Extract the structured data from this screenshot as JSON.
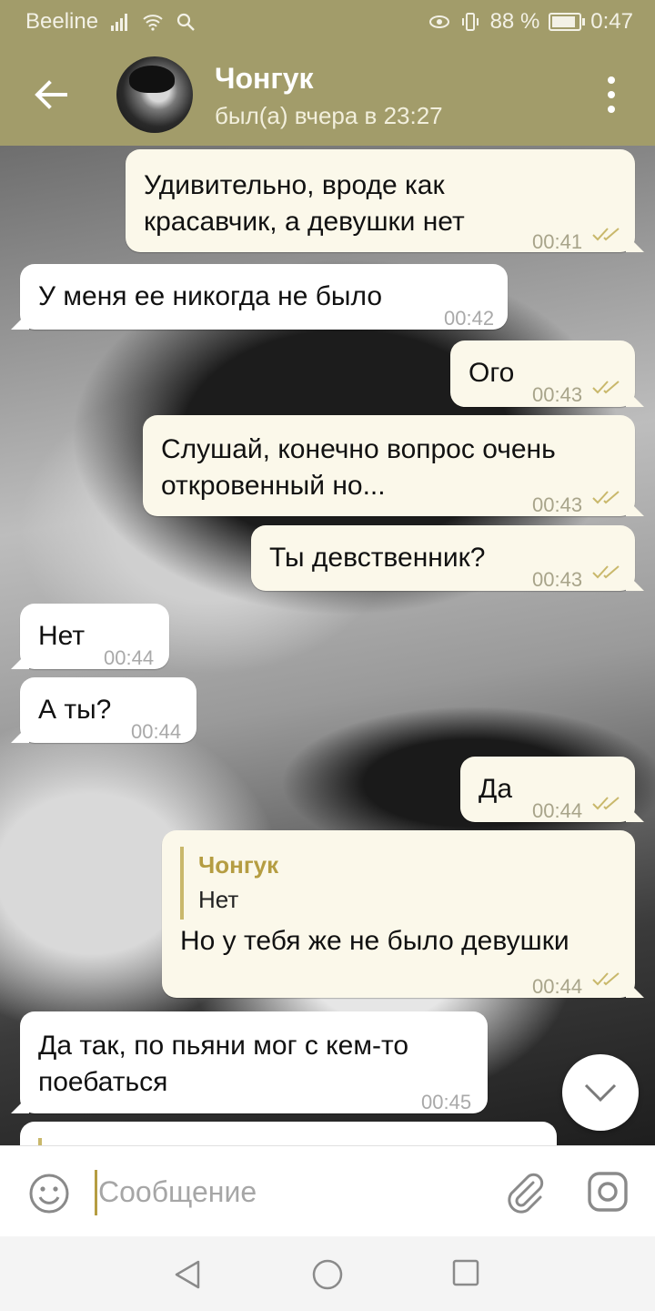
{
  "status_bar": {
    "carrier": "Beeline",
    "battery_percent": "88 %",
    "battery_level": 0.88,
    "time": "0:47"
  },
  "header": {
    "contact_name": "Чонгук",
    "last_seen": "был(а) вчера в 23:27"
  },
  "messages": [
    {
      "direction": "out",
      "lines": [
        "Удивительно, вроде как",
        "красавчик, а девушки нет"
      ],
      "time": "00:41",
      "status": "read"
    },
    {
      "direction": "in",
      "lines": [
        "У меня ее никогда не было"
      ],
      "time": "00:42"
    },
    {
      "direction": "out",
      "lines": [
        "Ого"
      ],
      "time": "00:43",
      "status": "read"
    },
    {
      "direction": "out",
      "lines": [
        "Слушай, конечно вопрос очень",
        "откровенный но..."
      ],
      "time": "00:43",
      "status": "read"
    },
    {
      "direction": "out",
      "lines": [
        "Ты девственник?"
      ],
      "time": "00:43",
      "status": "read"
    },
    {
      "direction": "in",
      "lines": [
        "Нет"
      ],
      "time": "00:44"
    },
    {
      "direction": "in",
      "lines": [
        "А ты?"
      ],
      "time": "00:44"
    },
    {
      "direction": "out",
      "lines": [
        "Да"
      ],
      "time": "00:44",
      "status": "read"
    },
    {
      "direction": "out",
      "reply_to": {
        "name": "Чонгук",
        "text": "Нет"
      },
      "lines": [
        "Но у тебя же не было девушки"
      ],
      "time": "00:44",
      "status": "read"
    },
    {
      "direction": "in",
      "lines": [
        "Да так, по пьяни мог с кем-то",
        "поебаться"
      ],
      "time": "00:45"
    }
  ],
  "composer": {
    "placeholder": "Сообщение"
  },
  "icons": {
    "back": "arrow-left-icon",
    "menu": "more-vert-icon",
    "emoji": "smile-icon",
    "attach": "paperclip-icon",
    "camera": "instagram-camera-icon",
    "scroll": "chevron-down-icon",
    "read_ticks": "double-check-icon"
  },
  "colors": {
    "accent": "#a29c6a",
    "outgoing_bubble": "#fbf8ea",
    "incoming_bubble": "#ffffff",
    "ticks": "#c9b86b"
  }
}
